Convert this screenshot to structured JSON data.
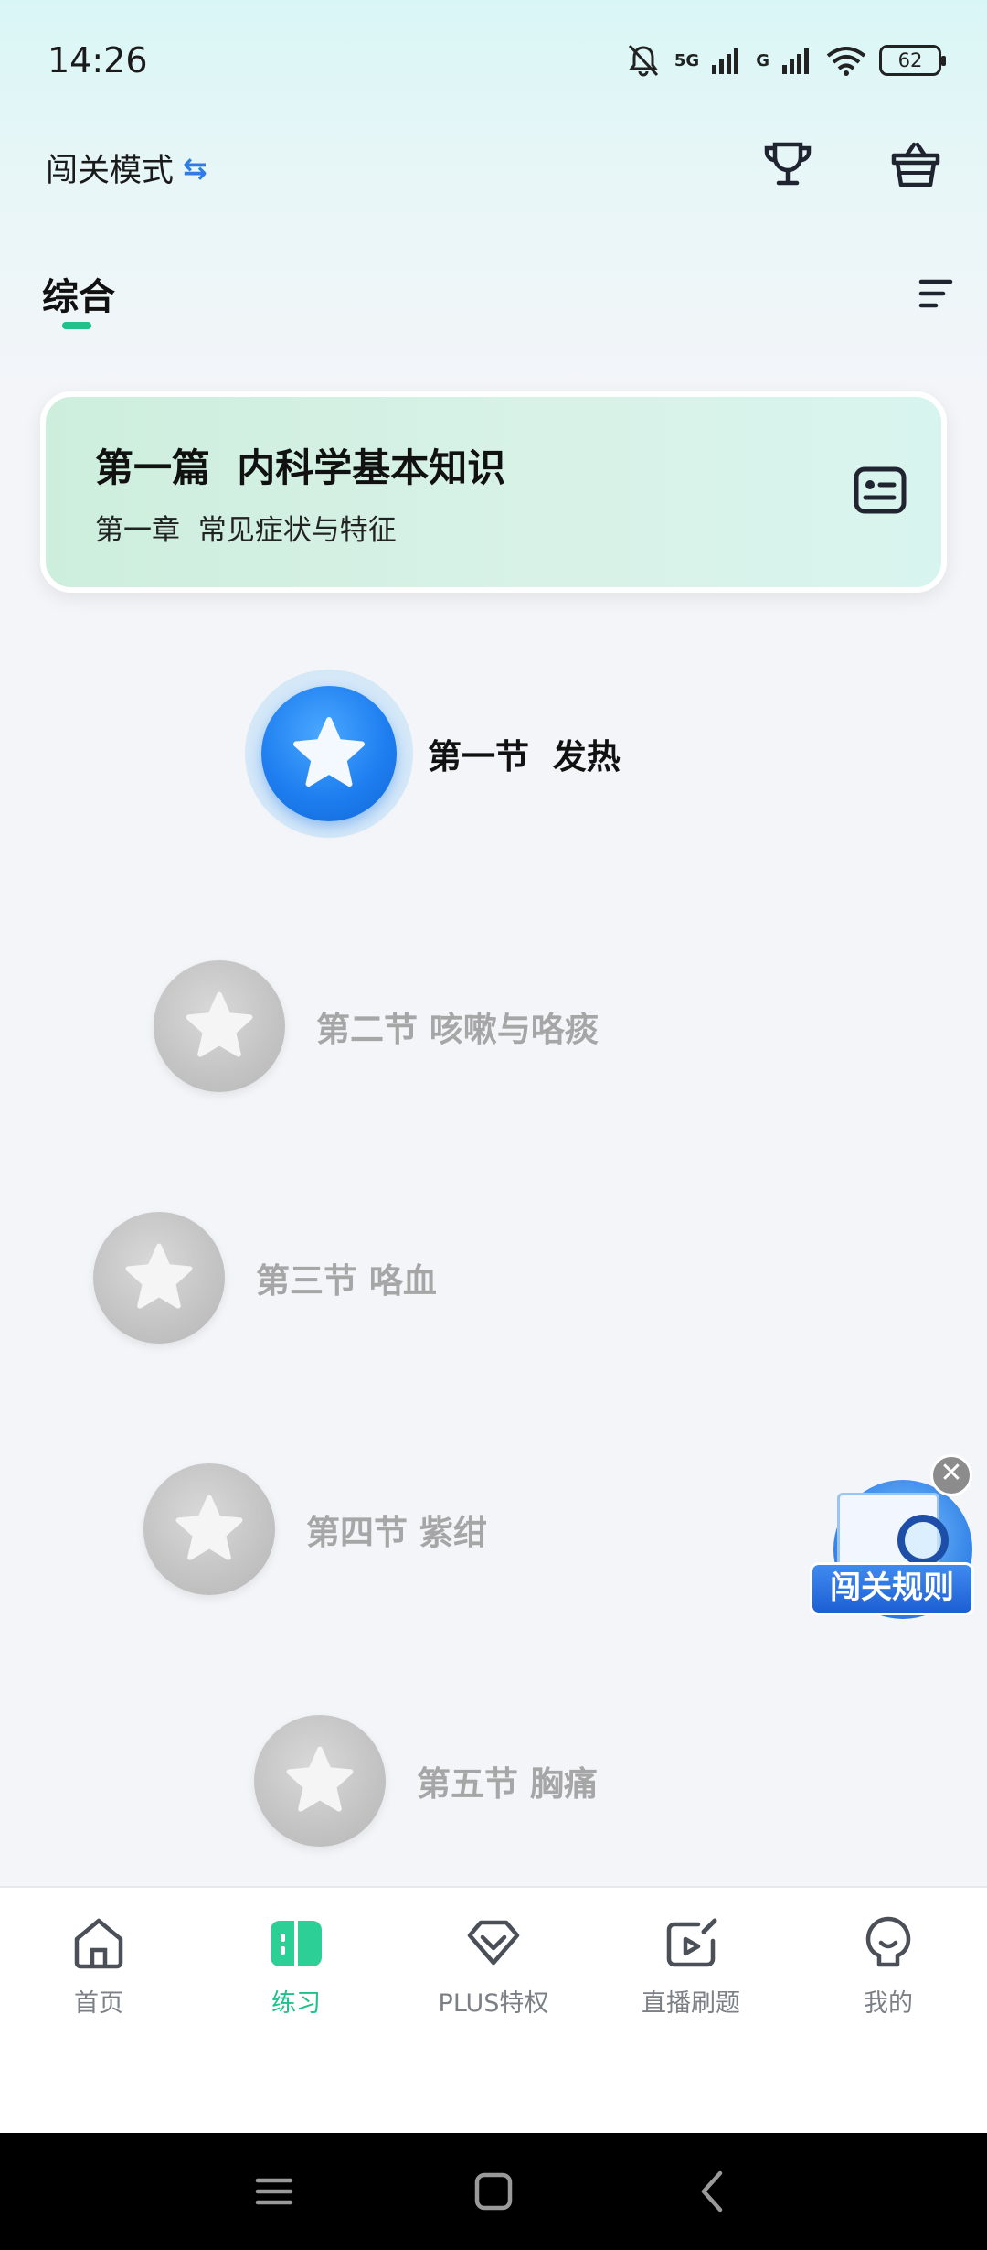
{
  "status_bar": {
    "time": "14:26",
    "signal_1_label": "5G",
    "signal_2_label": "G",
    "battery": "62",
    "icons": [
      "bell-muted-icon",
      "signal-icon",
      "signal-icon",
      "wifi-icon",
      "battery-icon"
    ]
  },
  "header": {
    "mode_label": "闯关模式",
    "mode_switch_icon": "⇆",
    "icons": [
      "trophy-icon",
      "basket-icon"
    ]
  },
  "tabs": {
    "active": "综合"
  },
  "chapter_card": {
    "title": "第一篇  内科学基本知识",
    "subtitle": "第一章  常见症状与特征",
    "icon": "card-list-icon"
  },
  "levels": [
    {
      "label": "第一节  发热",
      "state": "active"
    },
    {
      "label": "第二节 咳嗽与咯痰",
      "state": "locked"
    },
    {
      "label": "第三节 咯血",
      "state": "locked"
    },
    {
      "label": "第四节 紫绀",
      "state": "locked"
    },
    {
      "label": "第五节 胸痛",
      "state": "locked"
    }
  ],
  "rules_badge": {
    "label": "闯关规则",
    "close": "✕"
  },
  "bottom_nav": [
    {
      "label": "首页",
      "icon": "home-icon",
      "active": false
    },
    {
      "label": "练习",
      "icon": "practice-icon",
      "active": true
    },
    {
      "label": "PLUS特权",
      "icon": "diamond-icon",
      "active": false
    },
    {
      "label": "直播刷题",
      "icon": "live-icon",
      "active": false
    },
    {
      "label": "我的",
      "icon": "profile-icon",
      "active": false
    }
  ],
  "colors": {
    "accent": "#22c08a",
    "active_orb": "#1f7ff0",
    "locked_text": "#a6a6a6"
  }
}
